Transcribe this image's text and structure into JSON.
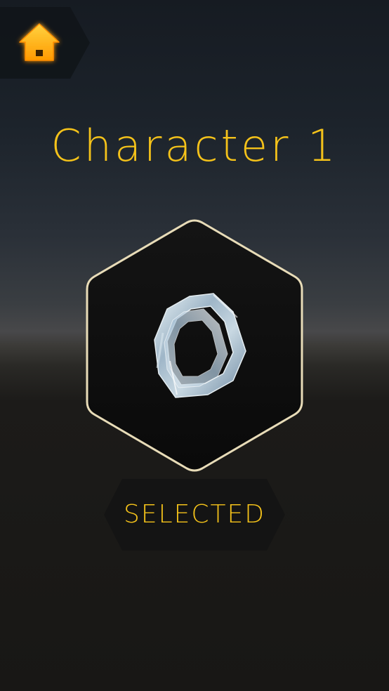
{
  "header": {
    "home_icon": "home-icon"
  },
  "character": {
    "title": "Character 1",
    "preview_icon": "glass-ring-model"
  },
  "select": {
    "label": "SELECTED"
  },
  "colors": {
    "accent": "#f4c21a",
    "home_glow": "#ffa010",
    "frame_border": "#e8dcb8",
    "panel_dark": "#0c0c0c"
  }
}
